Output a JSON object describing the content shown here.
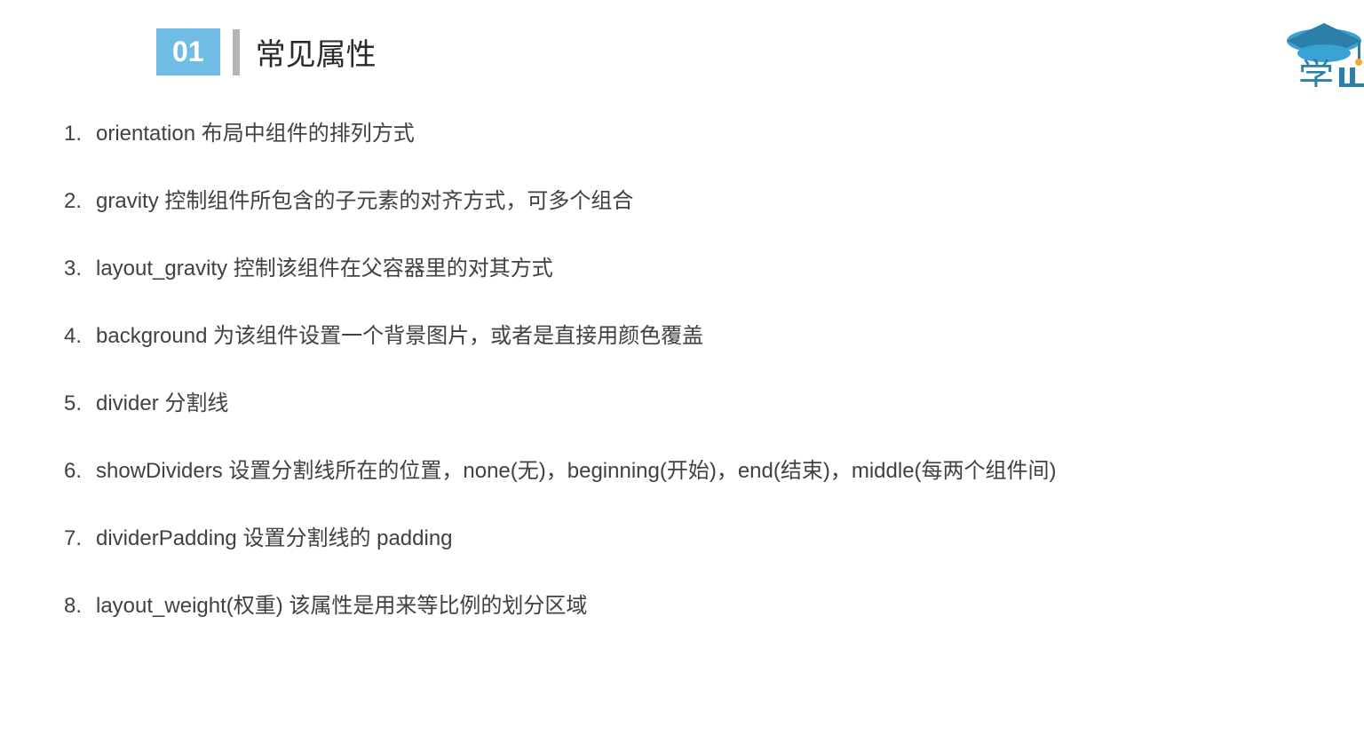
{
  "header": {
    "number": "01",
    "title": "常见属性"
  },
  "items": [
    "orientation 布局中组件的排列方式",
    "gravity 控制组件所包含的子元素的对齐方式，可多个组合",
    "layout_gravity 控制该组件在父容器里的对其方式",
    "background 为该组件设置一个背景图片，或者是直接用颜色覆盖",
    "divider 分割线",
    "showDividers 设置分割线所在的位置，none(无)，beginning(开始)，end(结束)，middle(每两个组件间)",
    "dividerPadding 设置分割线的 padding",
    "layout_weight(权重) 该属性是用来等比例的划分区域"
  ]
}
